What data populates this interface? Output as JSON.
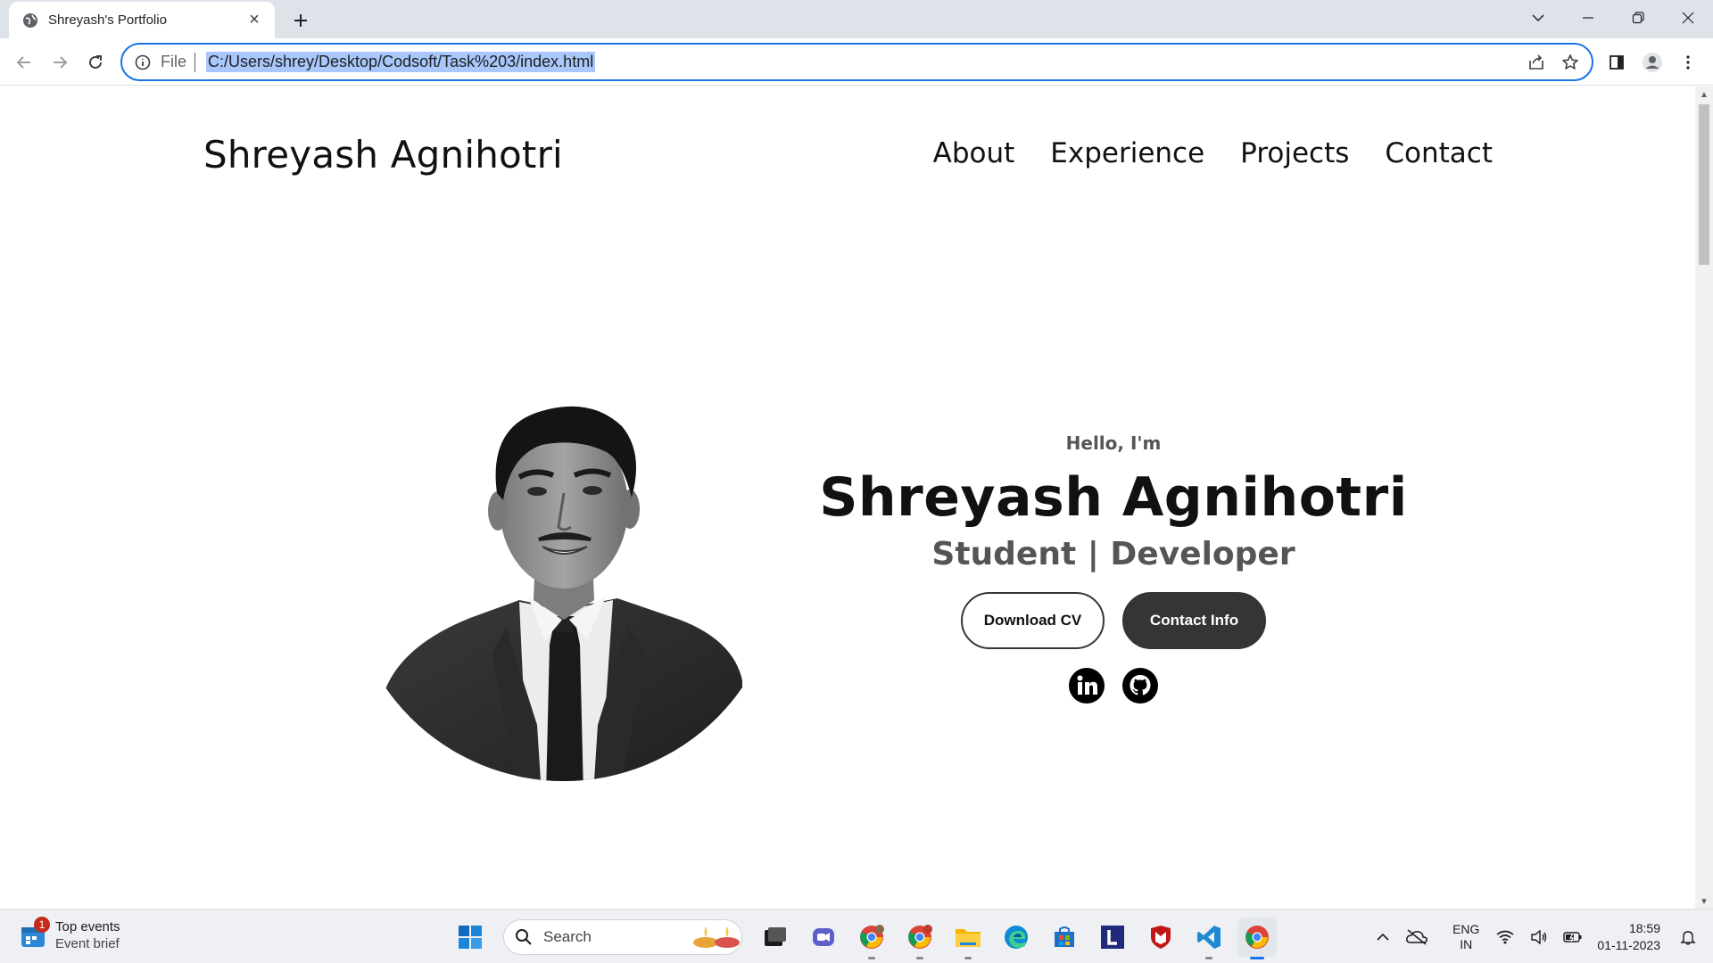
{
  "browser": {
    "tab_title": "Shreyash's Portfolio",
    "address_scheme": "File",
    "address_url": "C:/Users/shrey/Desktop/Codsoft/Task%203/index.html"
  },
  "page": {
    "logo": "Shreyash Agnihotri",
    "nav": [
      "About",
      "Experience",
      "Projects",
      "Contact"
    ],
    "hero": {
      "greeting": "Hello, I'm",
      "name": "Shreyash Agnihotri",
      "role": "Student | Developer",
      "btn_download": "Download CV",
      "btn_contact": "Contact Info"
    },
    "socials": [
      "linkedin-icon",
      "github-icon"
    ]
  },
  "taskbar": {
    "widget_title": "Top events",
    "widget_subtitle": "Event brief",
    "widget_badge": "1",
    "search_label": "Search",
    "lang_top": "ENG",
    "lang_bottom": "IN",
    "time": "18:59",
    "date": "01-11-2023"
  },
  "colors": {
    "accent": "#1a73e8",
    "button_dark": "#353535",
    "tabbar_bg": "#dee3ea"
  }
}
